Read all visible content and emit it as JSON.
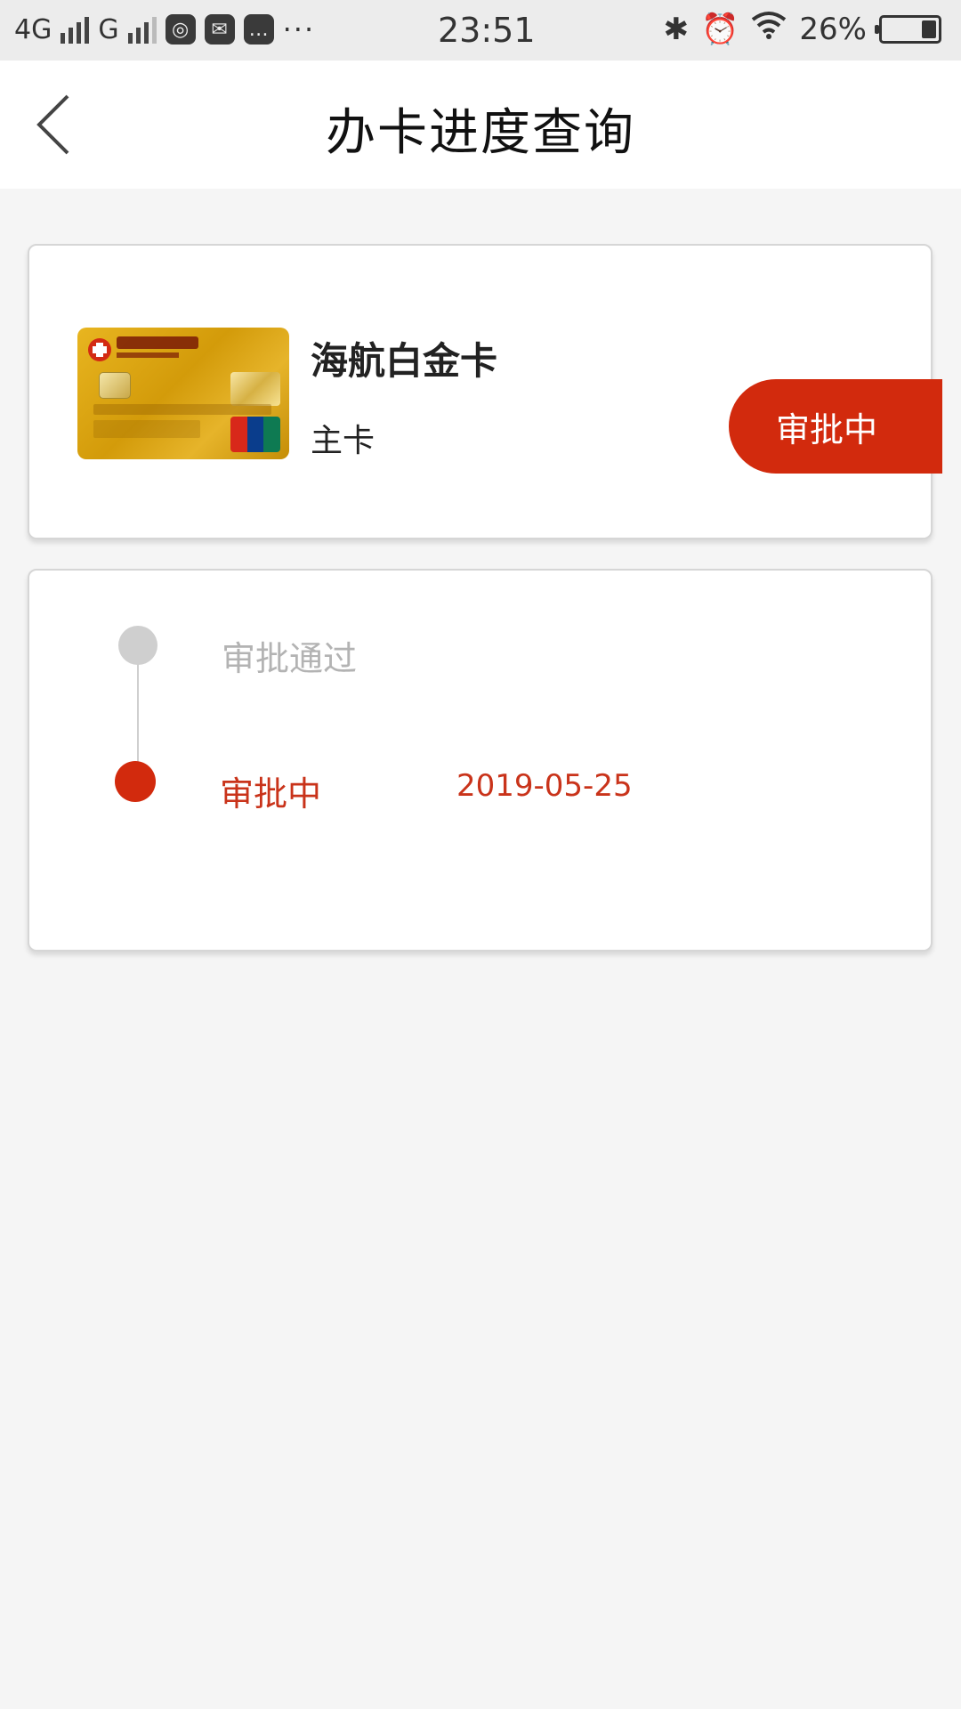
{
  "status_bar": {
    "network_1": "4G",
    "network_2": "G",
    "time": "23:51",
    "battery": "26%",
    "more": "···"
  },
  "header": {
    "title": "办卡进度查询"
  },
  "card": {
    "name": "海航白金卡",
    "type": "主卡",
    "status": "审批中"
  },
  "progress": {
    "steps": [
      {
        "label": "审批通过",
        "date": ""
      },
      {
        "label": "审批中",
        "date": "2019-05-25"
      }
    ]
  },
  "colors": {
    "accent": "#d22a0d",
    "inactive": "#cfcfcf"
  }
}
